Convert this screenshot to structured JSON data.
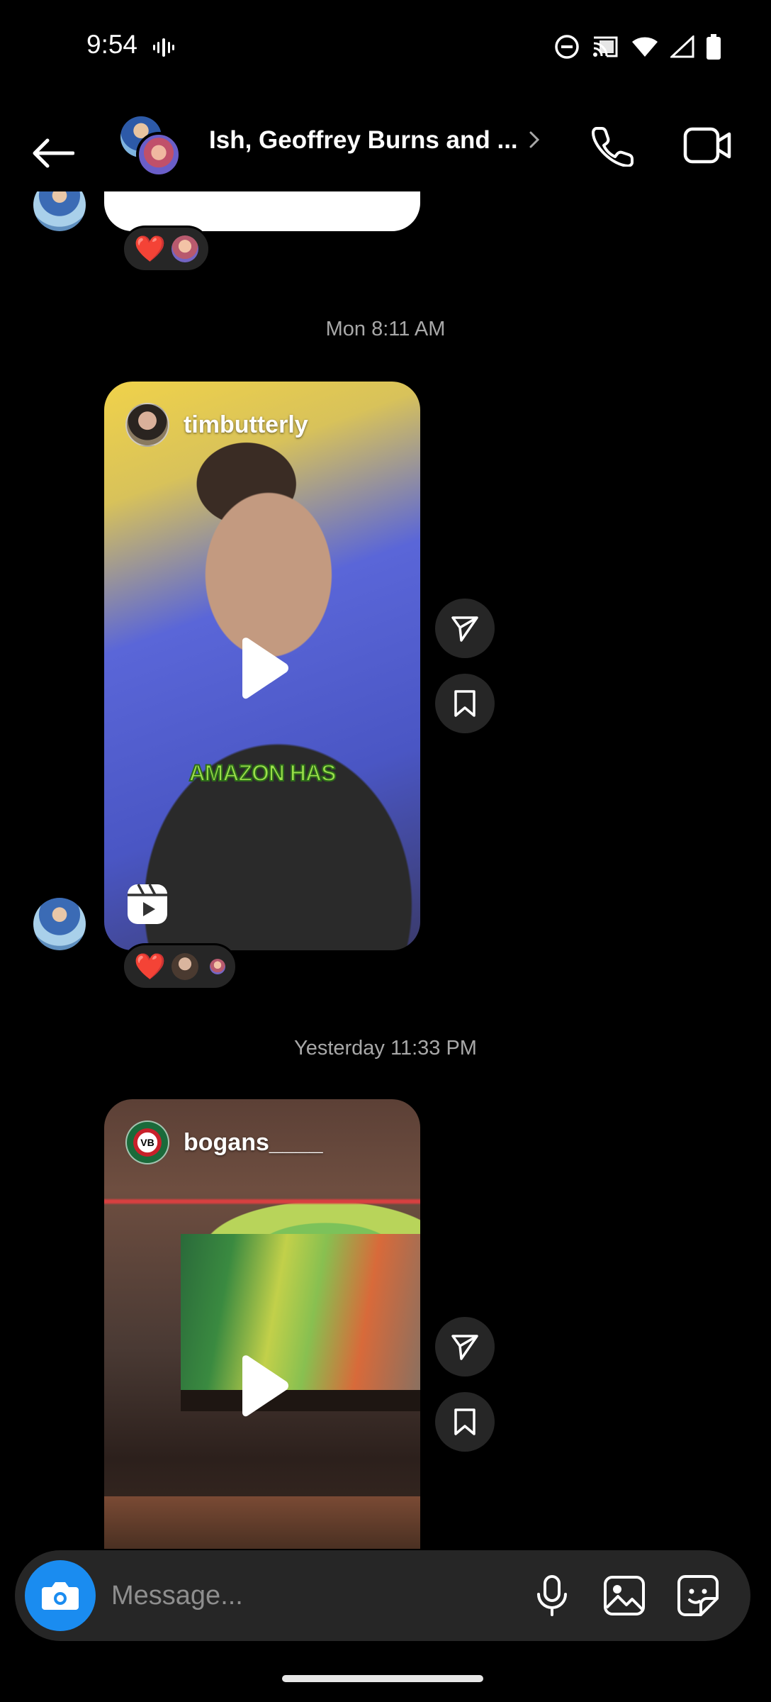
{
  "status_bar": {
    "time": "9:54",
    "icons": [
      "vibrate-icon",
      "do-not-disturb-icon",
      "cast-icon",
      "wifi-icon",
      "signal-icon",
      "battery-icon"
    ]
  },
  "header": {
    "title": "Ish, Geoffrey Burns and ...",
    "icons": [
      "back-arrow-icon",
      "chevron-right-icon",
      "phone-icon",
      "video-camera-icon"
    ]
  },
  "thread": {
    "first_reaction": {
      "emoji": "❤️"
    },
    "timestamps": [
      "Mon 8:11 AM",
      "Yesterday 11:33 PM"
    ],
    "reels": [
      {
        "owner": "timbutterly",
        "caption_text": "AMAZON HAS",
        "reaction_emoji": "❤️"
      },
      {
        "owner": "bogans____",
        "avatar_text": "VB"
      }
    ]
  },
  "composer": {
    "placeholder": "Message...",
    "icons": [
      "camera-icon",
      "microphone-icon",
      "gallery-icon",
      "sticker-icon"
    ]
  },
  "colors": {
    "background": "#000000",
    "bubble": "#262626",
    "accent_blue": "#1a8cf0",
    "timestamp_gray": "#a8a8a8"
  }
}
